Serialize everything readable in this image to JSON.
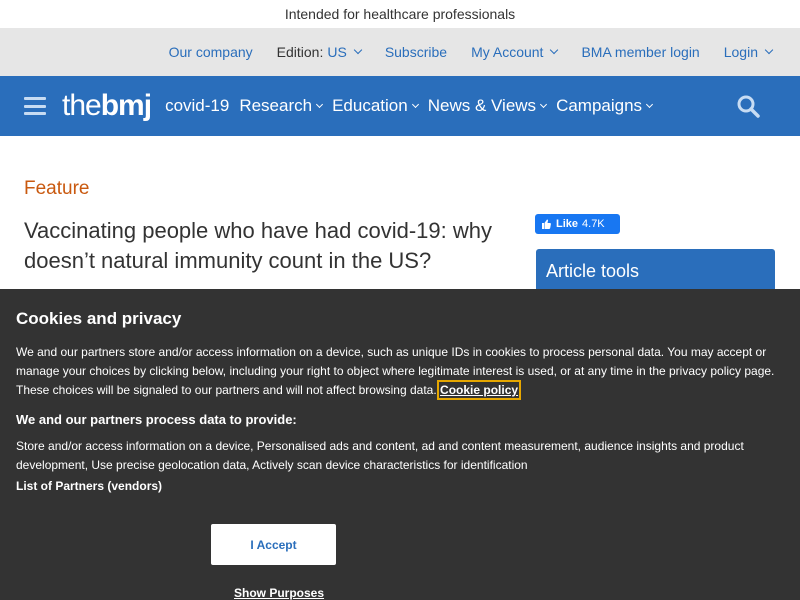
{
  "topbar": {
    "text": "Intended for healthcare professionals"
  },
  "utility_nav": {
    "our_company": "Our company",
    "edition_label": "Edition:",
    "edition_value": "US",
    "subscribe": "Subscribe",
    "my_account": "My Account",
    "bma_login": "BMA member login",
    "login": "Login"
  },
  "main_nav": {
    "logo_thin": "the",
    "logo_bold": "bmj",
    "items": [
      "covid-19",
      "Research",
      "Education",
      "News & Views",
      "Campaigns"
    ]
  },
  "article": {
    "type": "Feature",
    "title": "Vaccinating people who have had covid-19: why doesn’t natural immunity count in the US?"
  },
  "social": {
    "like_label": "Like",
    "like_count": "4.7K"
  },
  "sidebar": {
    "article_tools": "Article tools"
  },
  "cookie_banner": {
    "heading": "Cookies and privacy",
    "body": "We and our partners store and/or access information on a device, such as unique IDs in cookies to process personal data. You may accept or manage your choices by clicking below, including your right to object where legitimate interest is used, or at any time in the privacy policy page. These choices will be signaled to our partners and will not affect browsing data.",
    "policy_link": "Cookie policy",
    "purposes_heading": "We and our partners process data to provide:",
    "purposes_text": "Store and/or access information on a device, Personalised ads and content, ad and content measurement, audience insights and product development, Use precise geolocation data, Actively scan device characteristics for identification",
    "partners_link": "List of Partners (vendors)",
    "accept_button": "I Accept",
    "show_purposes": "Show Purposes"
  },
  "colors": {
    "brand_blue": "#2a6ebb",
    "feature_orange": "#c9590f",
    "banner_bg": "#333333",
    "facebook_blue": "#1877f2"
  }
}
